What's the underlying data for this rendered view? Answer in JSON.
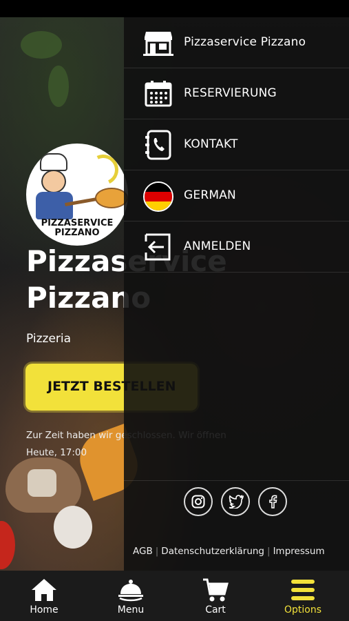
{
  "background": {
    "logo_text": [
      "PIZZASERVICE",
      "PIZZANO"
    ],
    "restaurant_name_line1": "Pizzaservice",
    "restaurant_name_line2": "Pizzano",
    "category": "Pizzeria",
    "order_button": "JETZT BESTELLEN",
    "notice_line1": "Zur Zeit haben wir geschlossen. Wir öffnen",
    "notice_line2": "Heute, 17:00"
  },
  "drawer": {
    "items": [
      {
        "label": "Pizzaservice Pizzano",
        "icon": "store-icon"
      },
      {
        "label": "RESERVIERUNG",
        "icon": "calendar-icon"
      },
      {
        "label": "KONTAKT",
        "icon": "phone-book-icon"
      },
      {
        "label": "GERMAN",
        "icon": "german-flag-icon"
      },
      {
        "label": "ANMELDEN",
        "icon": "login-icon"
      }
    ],
    "social": [
      "instagram-icon",
      "twitter-icon",
      "facebook-icon"
    ],
    "footer": {
      "agb": "AGB",
      "privacy": "Datenschutzerklärung",
      "imprint": "Impressum"
    }
  },
  "bottom_nav": {
    "items": [
      {
        "label": "Home",
        "icon": "home-icon"
      },
      {
        "label": "Menu",
        "icon": "cloche-icon"
      },
      {
        "label": "Cart",
        "icon": "cart-icon"
      },
      {
        "label": "Options",
        "icon": "hamburger-icon"
      }
    ],
    "active": "Options",
    "active_color": "#f2e13a"
  },
  "colors": {
    "accent": "#f2e13a",
    "flag_black": "#000000",
    "flag_red": "#dd0000",
    "flag_gold": "#ffce00"
  }
}
